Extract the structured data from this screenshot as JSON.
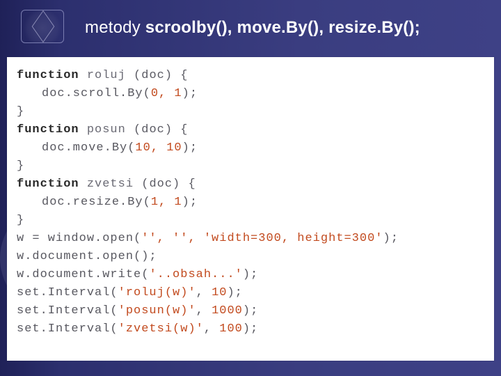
{
  "title": {
    "prefix": "metody ",
    "bold": "scroolby(), move.By(), resize.By();"
  },
  "code": {
    "lines": [
      {
        "kind": "func-decl",
        "keyword": "function",
        "name": "roluj",
        "params": "(doc)",
        "brace": "{"
      },
      {
        "kind": "stmt",
        "indent": true,
        "text_pre": "doc.scroll.By(",
        "num": "0, 1",
        "text_post": ");"
      },
      {
        "kind": "brace",
        "text": "}"
      },
      {
        "kind": "func-decl",
        "keyword": "function",
        "name": "posun",
        "params": "(doc)",
        "brace": "{"
      },
      {
        "kind": "stmt",
        "indent": true,
        "text_pre": "doc.move.By(",
        "num": "10, 10",
        "text_post": ");"
      },
      {
        "kind": "brace",
        "text": "}"
      },
      {
        "kind": "func-decl",
        "keyword": "function",
        "name": "zvetsi",
        "params": "(doc)",
        "brace": "{"
      },
      {
        "kind": "stmt",
        "indent": true,
        "text_pre": "doc.resize.By(",
        "num": "1, 1",
        "text_post": ");"
      },
      {
        "kind": "brace",
        "text": "}"
      },
      {
        "kind": "open",
        "text_pre": "w = window.open(",
        "str": "'', '', 'width=300, height=300'",
        "text_post": ");"
      },
      {
        "kind": "plain",
        "text": "w.document.open();"
      },
      {
        "kind": "open",
        "text_pre": "w.document.write(",
        "str": "'..obsah...'",
        "text_post": ");"
      },
      {
        "kind": "interval",
        "text_pre": "set.Interval(",
        "str": "'roluj(w)'",
        "sep": ", ",
        "num": "10",
        "text_post": ");"
      },
      {
        "kind": "interval",
        "text_pre": "set.Interval(",
        "str": "'posun(w)'",
        "sep": ", ",
        "num": "1000",
        "text_post": ");"
      },
      {
        "kind": "interval",
        "text_pre": "set.Interval(",
        "str": "'zvetsi(w)'",
        "sep": ", ",
        "num": "100",
        "text_post": ");"
      }
    ]
  }
}
